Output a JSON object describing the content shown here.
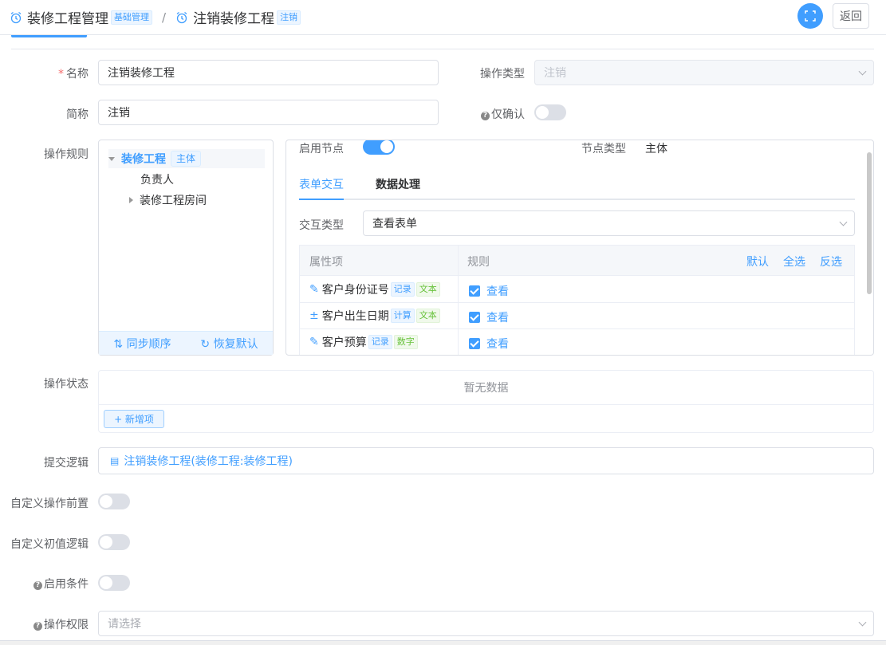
{
  "header": {
    "crumb1": "装修工程管理",
    "crumb1_tag": "基础管理",
    "sep": "/",
    "crumb2": "注销装修工程",
    "crumb2_tag": "注销",
    "back_label": "返回"
  },
  "form": {
    "name_label": "名称",
    "name_value": "注销装修工程",
    "op_type_label": "操作类型",
    "op_type_value": "注销",
    "short_label": "简称",
    "short_value": "注销",
    "confirm_only_label": "仅确认",
    "confirm_only": false,
    "rules_label": "操作规则",
    "status_label": "操作状态",
    "submit_label": "提交逻辑",
    "custom_pre_label": "自定义操作前置",
    "custom_pre": false,
    "custom_init_label": "自定义初值逻辑",
    "custom_init": false,
    "enable_cond_label": "启用条件",
    "enable_cond": false,
    "perm_label": "操作权限",
    "perm_placeholder": "请选择"
  },
  "tree": {
    "root": "装修工程",
    "root_tag": "主体",
    "child1": "负责人",
    "child2": "装修工程房间",
    "sync_label": "同步顺序",
    "reset_label": "恢复默认"
  },
  "panel": {
    "enable_node_label": "启用节点",
    "enable_node": true,
    "node_type_label": "节点类型",
    "node_type_value": "主体",
    "tab1": "表单交互",
    "tab2": "数据处理",
    "interact_label": "交互类型",
    "interact_value": "查看表单",
    "col_attr": "属性项",
    "col_rule": "规则",
    "act_default": "默认",
    "act_all": "全选",
    "act_invert": "反选",
    "rows": [
      {
        "name": "客户身份证号",
        "tag1": "记录",
        "tag2": "文本",
        "rule": "查看"
      },
      {
        "name": "客户出生日期",
        "tag1": "计算",
        "tag2": "文本",
        "rule": "查看"
      },
      {
        "name": "客户预算",
        "tag1": "记录",
        "tag2": "数字",
        "rule": "查看"
      }
    ]
  },
  "status": {
    "empty": "暂无数据",
    "add_label": "+ 新增项"
  },
  "submit_logic": {
    "value": "注销装修工程(装修工程:装修工程)"
  },
  "colors": {
    "primary": "#409eff",
    "success": "#67c23a"
  }
}
